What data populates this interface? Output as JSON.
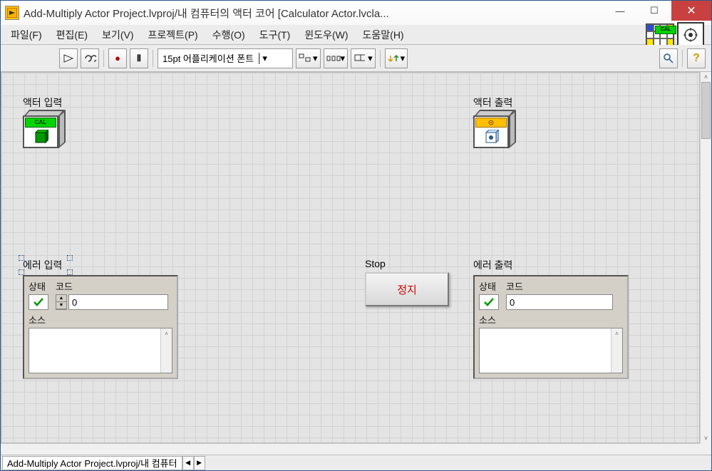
{
  "title": "Add-Multiply Actor Project.lvproj/내 컴퓨터의 액터 코어 [Calculator Actor.lvcla...",
  "menu": {
    "file": "파일(F)",
    "edit": "편집(E)",
    "view": "보기(V)",
    "project": "프로젝트(P)",
    "operate": "수행(O)",
    "tools": "도구(T)",
    "window": "윈도우(W)",
    "help": "도움말(H)"
  },
  "toolbar": {
    "font": "15pt 어플리케이션 폰트"
  },
  "canvas": {
    "actor_in_label": "액터 입력",
    "actor_out_label": "액터 출력",
    "error_in_label": "에러 입력",
    "error_out_label": "에러 출력",
    "status_label": "상태",
    "code_label": "코드",
    "source_label": "소스",
    "code_value_in": "0",
    "code_value_out": "0",
    "stop_label": "Stop",
    "stop_button": "정지",
    "cal_text": "CAL"
  },
  "statusbar": {
    "path": "Add-Multiply Actor Project.lvproj/내 컴퓨터"
  }
}
